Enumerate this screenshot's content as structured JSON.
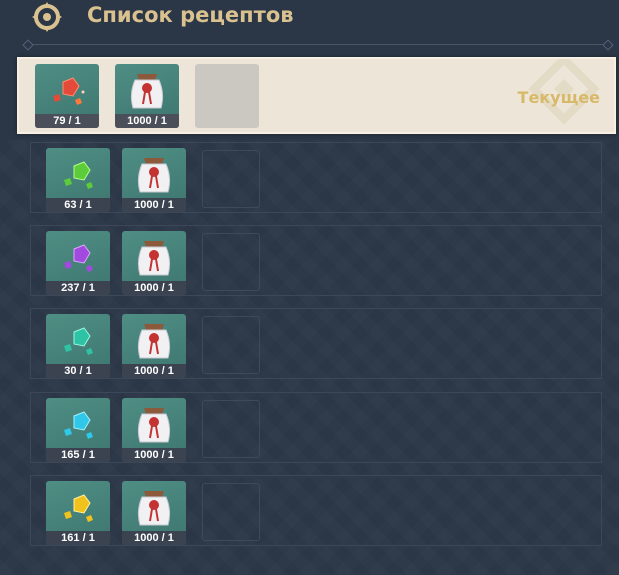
{
  "header": {
    "title": "Список рецептов"
  },
  "recipes": [
    {
      "status": "Текущее",
      "gem": {
        "color": "#e44a3a",
        "count": "79 / 1"
      },
      "bag": {
        "count": "1000 / 1"
      }
    },
    {
      "gem": {
        "color": "#5dcc3a",
        "count": "63 / 1"
      },
      "bag": {
        "count": "1000 / 1"
      }
    },
    {
      "gem": {
        "color": "#a249e0",
        "count": "237 / 1"
      },
      "bag": {
        "count": "1000 / 1"
      }
    },
    {
      "gem": {
        "color": "#2ec3a4",
        "count": "30 / 1"
      },
      "bag": {
        "count": "1000 / 1"
      }
    },
    {
      "gem": {
        "color": "#2fc8e8",
        "count": "165 / 1"
      },
      "bag": {
        "count": "1000 / 1"
      }
    },
    {
      "gem": {
        "color": "#f2c21c",
        "count": "161 / 1"
      },
      "bag": {
        "count": "1000 / 1"
      }
    }
  ]
}
